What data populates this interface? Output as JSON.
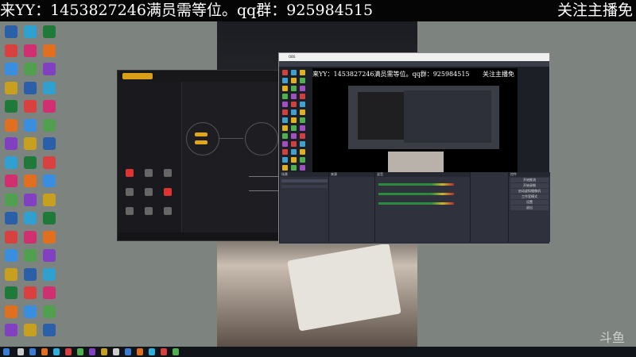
{
  "banner": {
    "left_text": "来YY：1453827246满员需等位。qq群：925984515",
    "right_text": "关注主播免"
  },
  "obs": {
    "preview_text": "来YY：1453827246满员需等位。qq群：925984515",
    "preview_right": "关注主播免",
    "docks": [
      "来源",
      "混音",
      "场景",
      "控件"
    ],
    "controls": [
      "开始推流",
      "开始录制",
      "启动虚拟摄像机",
      "工作室模式",
      "设置",
      "退出"
    ]
  },
  "watermark": "斗鱼",
  "taskbar_icon_count": 14
}
